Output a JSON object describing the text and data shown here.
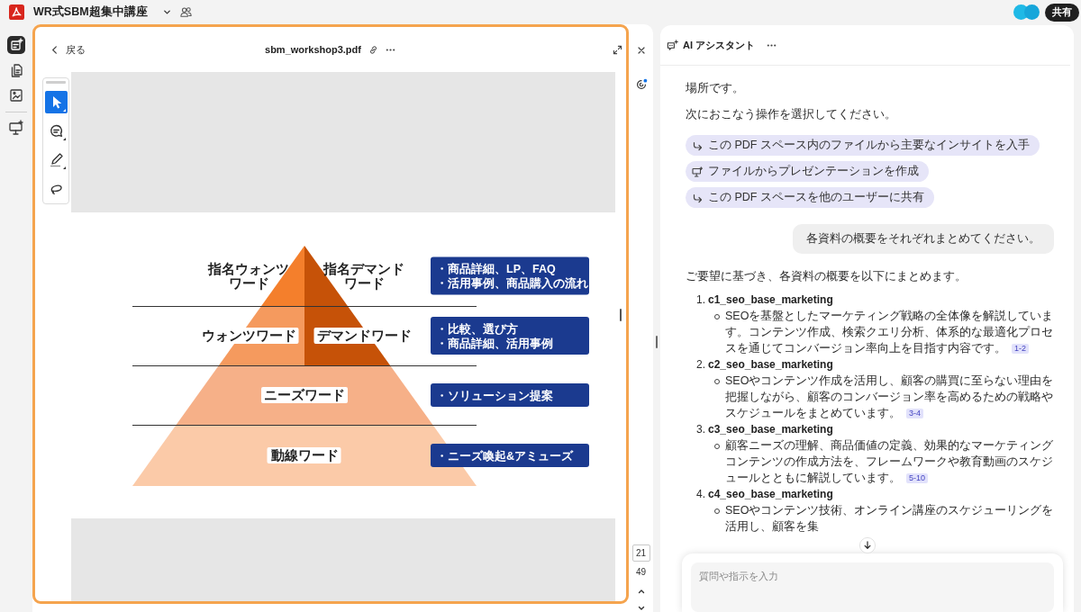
{
  "app_bar": {
    "title": "WR式SBM超集中講座",
    "share_label": "共有"
  },
  "rail": {
    "items": [
      {
        "selected": true
      },
      {
        "selected": false
      },
      {
        "selected": false
      },
      {
        "selected": false
      }
    ]
  },
  "viewer": {
    "back_label": "戻る",
    "file_name": "sbm_workshop3.pdf",
    "tools": [
      {
        "selected": true
      },
      {
        "selected": false
      },
      {
        "selected": false
      },
      {
        "selected": false
      }
    ],
    "slide": {
      "tiers": [
        {
          "boxed": false,
          "parts": [
            {
              "color": "#f47f2c",
              "label": [
                "指名ウォンツ",
                "ワード"
              ]
            },
            {
              "color": "#c65208",
              "label": [
                "指名デマンド",
                "ワード"
              ]
            }
          ],
          "notes": [
            "・商品詳細、LP、FAQ",
            "・活用事例、商品購入の流れ"
          ]
        },
        {
          "boxed": true,
          "parts": [
            {
              "color": "#f59a5e",
              "label": [
                "ウォンツワード"
              ]
            },
            {
              "color": "#c65208",
              "label": [
                "デマンドワード"
              ]
            }
          ],
          "notes": [
            "・比較、選び方",
            "・商品詳細、活用事例"
          ]
        },
        {
          "boxed": true,
          "parts": [
            {
              "color": "#f6b088",
              "label": [
                "ニーズワード"
              ]
            }
          ],
          "notes": [
            "・ソリューション提案"
          ]
        },
        {
          "boxed": true,
          "parts": [
            {
              "color": "#fbcaa8",
              "label": [
                "動線ワード"
              ]
            }
          ],
          "notes": [
            "・ニーズ喚起&アミューズ"
          ]
        }
      ]
    },
    "page_field": "21",
    "page_count": "49"
  },
  "assistant": {
    "title": "AI アシスタント",
    "lead_text": "場所です。",
    "prompt_text": "次におこなう操作を選択してください。",
    "suggestions": [
      {
        "kind": "arrow",
        "label": "この PDF スペース内のファイルから主要なインサイトを入手"
      },
      {
        "kind": "presentation",
        "label": "ファイルからプレゼンテーションを作成"
      },
      {
        "kind": "arrow",
        "label": "この PDF スペースを他のユーザーに共有"
      }
    ],
    "user_message": "各資料の概要をそれぞれまとめてください。",
    "reply_intro": "ご要望に基づき、各資料の概要を以下にまとめます。",
    "summaries": [
      {
        "number": "1.",
        "title": "c1_seo_base_marketing",
        "text": "SEOを基盤としたマーケティング戦略の全体像を解説しています。コンテンツ作成、検索クエリ分析、体系的な最適化プロセスを通じてコンバージョン率向上を目指す内容です。",
        "citation": "1-2"
      },
      {
        "number": "2.",
        "title": "c2_seo_base_marketing",
        "text": "SEOやコンテンツ作成を活用し、顧客の購買に至らない理由を把握しながら、顧客のコンバージョン率を高めるための戦略やスケジュールをまとめています。",
        "citation": "3-4"
      },
      {
        "number": "3.",
        "title": "c3_seo_base_marketing",
        "text": "顧客ニーズの理解、商品価値の定義、効果的なマーケティングコンテンツの作成方法を、フレームワークや教育動画のスケジュールとともに解説しています。",
        "citation": "5-10"
      },
      {
        "number": "4.",
        "title": "c4_seo_base_marketing",
        "text": "SEOやコンテンツ技術、オンライン講座のスケジューリングを活用し、顧客を集"
      }
    ],
    "input": {
      "placeholder": "質問や指示を入力"
    }
  }
}
